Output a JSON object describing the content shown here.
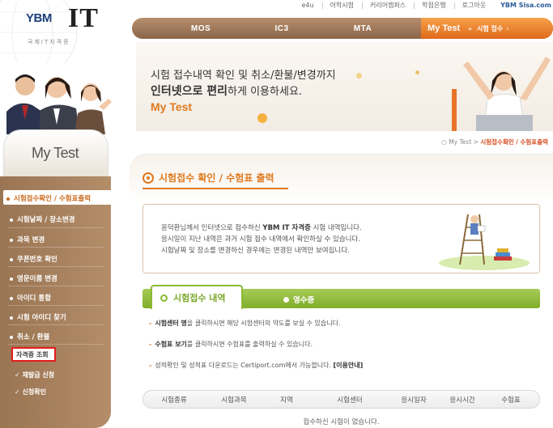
{
  "util_links": [
    "e4u",
    "어학시험",
    "커리어캠퍼스",
    "학점은행",
    "로그아웃"
  ],
  "util_brand": "YBM Sisa.com",
  "logo": {
    "ybm": "YBM",
    "it": "IT",
    "sub": "국제IT자격증"
  },
  "nav": {
    "items": [
      "MOS",
      "IC3",
      "MTA"
    ],
    "active": "My Test",
    "active_sub": "시험 접수"
  },
  "banner": {
    "line1": "시험 접수내역 확인 및 취소/환불/변경까지",
    "line2_bold": "인터넷으로 편리",
    "line2_rest": "하게 이용하세요.",
    "brand": "My Test"
  },
  "sidebar": {
    "title": "My Test",
    "items": [
      "시험접수확인 / 수험표출력",
      "시험날짜 / 장소변경",
      "과목 변경",
      "쿠폰번호 확인",
      "영문이름 변경",
      "아이디 통합",
      "시험 아이디 찾기",
      "취소 / 환불"
    ],
    "sub_current": "자격증 조회",
    "sub_items": [
      "✓ 재발급 신청",
      "✓ 신청확인"
    ]
  },
  "breadcrumb": {
    "home": "My Test",
    "mid": "시험접수확인",
    "current": "수험표출력"
  },
  "page_title": "시험접수 확인 / 수험표 출력",
  "info": {
    "line1_pre": "윤덕환님께서 인터넷으로 접수하신 ",
    "line1_bold": "YBM IT 자격증",
    "line1_post": " 시험 내역입니다.",
    "line2": "응시일이 지난 내역은 과거 시험 접수 내역에서 확인하실 수 있습니다.",
    "line3": "시험날짜 및 장소를 변경하신 경우에는 변경된 내역만 보여집니다."
  },
  "tabs": {
    "active": "시험접수 내역",
    "second": "영수증"
  },
  "notes": [
    {
      "bold": "시험센터 명",
      "rest": "을 클릭하시면 해당 시험센터의 약도를 보실 수 있습니다."
    },
    {
      "bold": "수험표 보기",
      "rest": "를 클릭하시면 수험표를 출력하실 수 있습니다."
    },
    {
      "bold": "",
      "rest": "성적확인 및 성적표 다운로드는 Certiport.com에서 가능합니다. ",
      "link": "[이용안내]"
    }
  ],
  "table": {
    "headers": [
      "시험종류",
      "시험과목",
      "지역",
      "시험센터",
      "응시일자",
      "응시시간",
      "수험표"
    ],
    "empty": "접수하신 시험이 없습니다."
  },
  "colors": {
    "accent": "#e07a20",
    "nav_brown": "#9a7553",
    "tab_green": "#8cba34",
    "highlight": "#e21c1c"
  }
}
